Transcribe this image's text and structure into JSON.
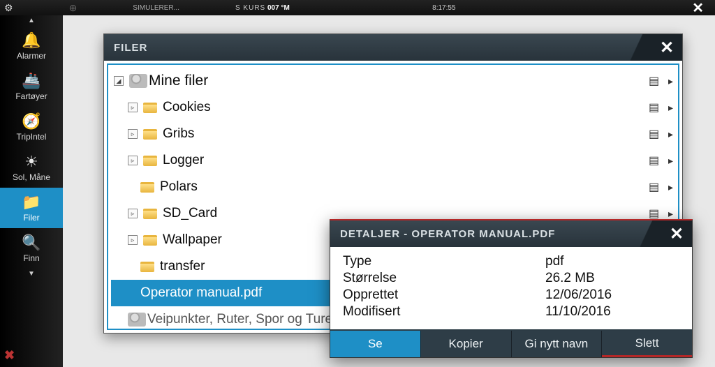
{
  "topbar": {
    "simulating": "SIMULERER...",
    "course_label": "S KURS",
    "course_value": "007 °M",
    "time": "8:17:55"
  },
  "sidebar": {
    "items": [
      {
        "icon": "bell",
        "label": "Alarmer"
      },
      {
        "icon": "ship",
        "label": "Fartøyer"
      },
      {
        "icon": "trip",
        "label": "TripIntel"
      },
      {
        "icon": "sun",
        "label": "Sol, Måne"
      },
      {
        "icon": "folder",
        "label": "Filer"
      },
      {
        "icon": "search",
        "label": "Finn"
      }
    ],
    "active_index": 4
  },
  "files_window": {
    "title": "FILER",
    "tree": {
      "root_label": "Mine filer",
      "children": [
        {
          "label": "Cookies",
          "expandable": true
        },
        {
          "label": "Gribs",
          "expandable": true
        },
        {
          "label": "Logger",
          "expandable": true
        },
        {
          "label": "Polars",
          "expandable": false
        },
        {
          "label": "SD_Card",
          "expandable": true
        },
        {
          "label": "Wallpaper",
          "expandable": true
        },
        {
          "label": "transfer",
          "expandable": false
        }
      ],
      "selected_file": "Operator manual.pdf",
      "cut_off_row": "Veipunkter, Ruter, Spor og Turer dat…"
    }
  },
  "details_window": {
    "title_prefix": "DETALJER - ",
    "title_file": "OPERATOR MANUAL.PDF",
    "rows": [
      {
        "label": "Type",
        "value": "pdf"
      },
      {
        "label": "Størrelse",
        "value": "26.2 MB"
      },
      {
        "label": "Opprettet",
        "value": "12/06/2016"
      },
      {
        "label": "Modifisert",
        "value": "11/10/2016"
      }
    ],
    "buttons": {
      "view": "Se",
      "copy": "Kopier",
      "rename": "Gi nytt navn",
      "delete": "Slett"
    }
  }
}
